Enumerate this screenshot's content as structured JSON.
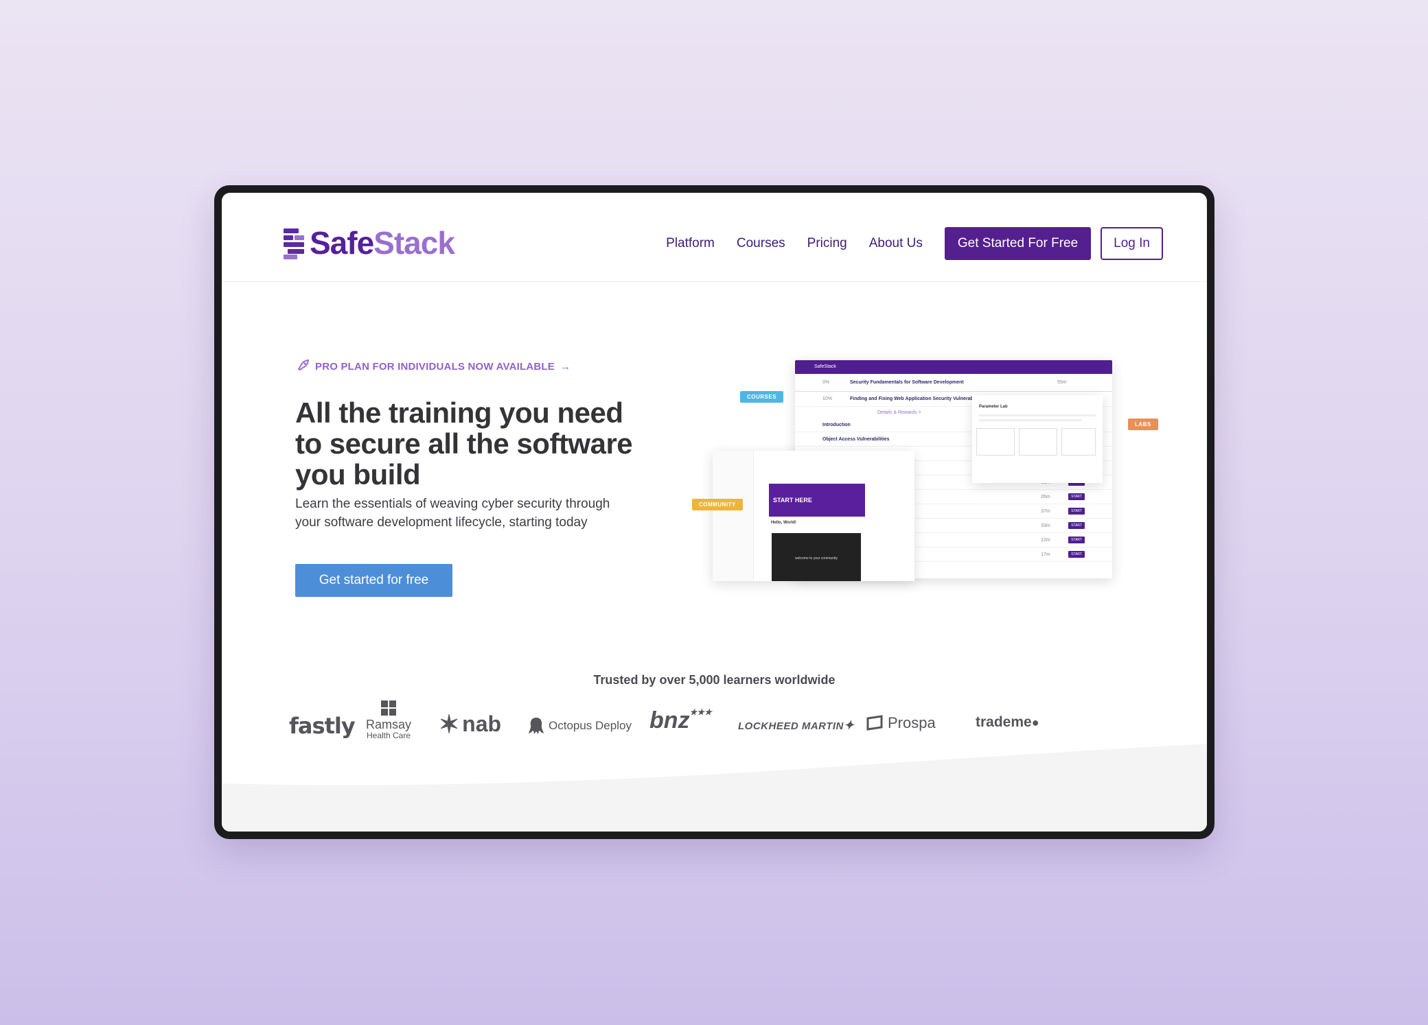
{
  "brand": {
    "name_part1": "Safe",
    "name_part2": "Stack",
    "primary_color": "#54208f",
    "accent_color": "#9a6fcf",
    "cta_color": "#4d8ed8",
    "logo_icon": "stacked-bars-logo-icon"
  },
  "nav": {
    "items": [
      {
        "label": "Platform"
      },
      {
        "label": "Courses"
      },
      {
        "label": "Pricing"
      },
      {
        "label": "About Us"
      }
    ],
    "primary_button": "Get Started For Free",
    "login_button": "Log In"
  },
  "hero": {
    "announcement": "PRO PLAN FOR INDIVIDUALS NOW AVAILABLE",
    "announcement_icon": "rocket-icon",
    "announcement_arrow": "→",
    "headline": "All the training you need to secure all the software you build",
    "subheadline": "Learn the essentials of weaving cyber security through your software development lifecycle, starting today",
    "cta": "Get started for free"
  },
  "mockup": {
    "tags": {
      "courses": "COURSES",
      "labs": "LABS",
      "community": "COMMUNITY"
    },
    "main_window": {
      "header": "SafeStack",
      "course1": "Security Fundamentals for Software Development",
      "course1_progress": "0%",
      "course1_duration": "55m",
      "course2": "Finding and Fixing Web Application Security Vulnerabilities",
      "course2_progress": "10%",
      "details_link": "Details & Rewards >",
      "lessons": [
        {
          "title": "Introduction",
          "duration": "4m"
        },
        {
          "title": "Object Access Vulnerabilities",
          "duration": "15m"
        },
        {
          "title": "",
          "duration": "26m"
        },
        {
          "title": "",
          "duration": "27m"
        },
        {
          "title": "",
          "duration": "13m"
        },
        {
          "title": "",
          "duration": "26m"
        },
        {
          "title": "",
          "duration": "37m"
        },
        {
          "title": "",
          "duration": "33m"
        },
        {
          "title": "",
          "duration": "22m"
        },
        {
          "title": "",
          "duration": "17m"
        }
      ],
      "start_label": "START"
    },
    "community_window": {
      "banner": "START HERE",
      "greeting": "Hello, World!",
      "video_caption": "welcome to your community"
    },
    "lab_window": {
      "title": "Parameter Lab"
    }
  },
  "trusted": {
    "text": "Trusted by over 5,000 learners worldwide",
    "logos": [
      {
        "name": "fastly",
        "text": "fastly"
      },
      {
        "name": "ramsay",
        "text": "Ramsay",
        "sub": "Health Care"
      },
      {
        "name": "nab",
        "text": "nab"
      },
      {
        "name": "octopus",
        "text": "Octopus Deploy"
      },
      {
        "name": "bnz",
        "text": "bnz"
      },
      {
        "name": "lockheed",
        "text": "LOCKHEED MARTIN"
      },
      {
        "name": "prospa",
        "text": "Prospa"
      },
      {
        "name": "trademe",
        "text": "trademe"
      }
    ]
  }
}
